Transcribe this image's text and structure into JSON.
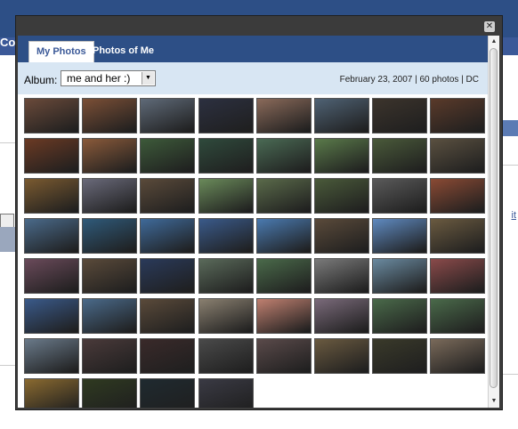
{
  "background": {
    "title_fragment": "Co",
    "right_link_fragment": "it"
  },
  "modal": {
    "close_glyph": "✕",
    "tabs": [
      {
        "label": "My Photos",
        "active": true
      },
      {
        "label": "Photos of Me",
        "active": false
      }
    ],
    "album_label": "Album:",
    "album_selected": "me and her :)",
    "meta": "February 23, 2007 | 60 photos | DC",
    "scroll_up_glyph": "▲",
    "scroll_down_glyph": "▼",
    "select_arrow_glyph": "▼"
  },
  "photos": [
    {
      "color": "#6a4a3a"
    },
    {
      "color": "#7b4f36"
    },
    {
      "color": "#5f6a78"
    },
    {
      "color": "#2c3040"
    },
    {
      "color": "#8a6a5a"
    },
    {
      "color": "#4f6274"
    },
    {
      "color": "#3c342c"
    },
    {
      "color": "#5a3a2a"
    },
    {
      "color": "#6b3a24"
    },
    {
      "color": "#8a5a3a"
    },
    {
      "color": "#3d5a3a"
    },
    {
      "color": "#2f4a3c"
    },
    {
      "color": "#4a6a54"
    },
    {
      "color": "#5a7a4a"
    },
    {
      "color": "#4a5a3a"
    },
    {
      "color": "#5a5040"
    },
    {
      "color": "#7a5a30"
    },
    {
      "color": "#6a6a7a"
    },
    {
      "color": "#5a4a3a"
    },
    {
      "color": "#6a8a5a"
    },
    {
      "color": "#5a6a4a"
    },
    {
      "color": "#4a5a3a"
    },
    {
      "color": "#5a5a5a"
    },
    {
      "color": "#8a4a34"
    },
    {
      "color": "#4a6a8a"
    },
    {
      "color": "#2f5a7a"
    },
    {
      "color": "#3f6a9a"
    },
    {
      "color": "#3a5a8a"
    },
    {
      "color": "#4a7ab0"
    },
    {
      "color": "#5a4a3a"
    },
    {
      "color": "#5f8ac0"
    },
    {
      "color": "#6a5a40"
    },
    {
      "color": "#6a4a5a"
    },
    {
      "color": "#5a4a3a"
    },
    {
      "color": "#2a3a5a"
    },
    {
      "color": "#5a6a5a"
    },
    {
      "color": "#4a6a4a"
    },
    {
      "color": "#7a7a7a"
    },
    {
      "color": "#6a8aa0"
    },
    {
      "color": "#8a4a4a"
    },
    {
      "color": "#3a5a8a"
    },
    {
      "color": "#4a6a8a"
    },
    {
      "color": "#5a4a3a"
    },
    {
      "color": "#8a8070"
    },
    {
      "color": "#c08070"
    },
    {
      "color": "#7a6a7a"
    },
    {
      "color": "#4a6a4a"
    },
    {
      "color": "#4a6a4a"
    },
    {
      "color": "#6a7a8a"
    },
    {
      "color": "#4a3a3a"
    },
    {
      "color": "#3a2a2a"
    },
    {
      "color": "#4a4a4a"
    },
    {
      "color": "#5a4a4a"
    },
    {
      "color": "#6a5a40"
    },
    {
      "color": "#3a3a2a"
    },
    {
      "color": "#7a6a5a"
    },
    {
      "color": "#8a6a30"
    },
    {
      "color": "#2f3a20"
    },
    {
      "color": "#1f2a30"
    },
    {
      "color": "#3a3a44"
    }
  ]
}
